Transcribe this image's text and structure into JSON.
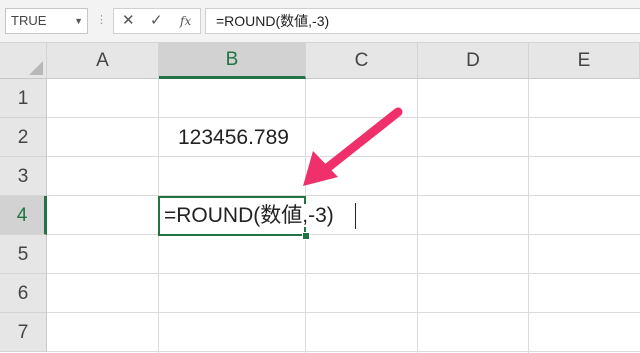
{
  "formula_bar": {
    "name_box": "TRUE",
    "cancel_symbol": "✕",
    "enter_symbol": "✓",
    "function_symbol": "fx",
    "formula": "=ROUND(数値,-3)"
  },
  "columns": [
    "A",
    "B",
    "C",
    "D",
    "E"
  ],
  "rows": [
    "1",
    "2",
    "3",
    "4",
    "5",
    "6",
    "7"
  ],
  "selected_column": "B",
  "selected_row": "4",
  "cells": {
    "B2": "123456.789",
    "B4": "=ROUND(数値,-3)"
  },
  "colors": {
    "accent": "#217346",
    "arrow": "#f0306a"
  }
}
